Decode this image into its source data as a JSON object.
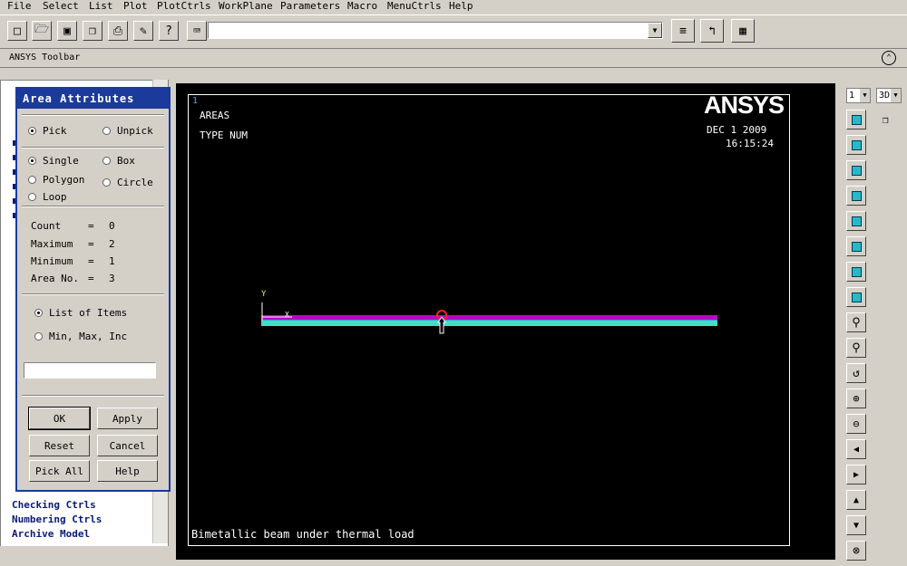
{
  "menu": {
    "items": [
      "File",
      "Select",
      "List",
      "Plot",
      "PlotCtrls",
      "WorkPlane",
      "Parameters",
      "Macro",
      "MenuCtrls",
      "Help"
    ]
  },
  "toolbar": {
    "icons": [
      "new-file-icon",
      "open-folder-icon",
      "save-icon",
      "model-icon",
      "print-icon",
      "report-icon",
      "help-icon",
      "keyboard-icon"
    ],
    "command_value": "",
    "right_icons": [
      "raise-hidden-icon",
      "reset-picking-icon",
      "contact-manager-icon"
    ]
  },
  "ansys_toolbar": {
    "label": "ANSYS Toolbar"
  },
  "main_menu": {
    "bottom_items": [
      "Checking Ctrls",
      "Numbering Ctrls",
      "Archive Model"
    ]
  },
  "dialog": {
    "title": "Area Attributes",
    "pick_label": "Pick",
    "unpick_label": "Unpick",
    "single_label": "Single",
    "box_label": "Box",
    "polygon_label": "Polygon",
    "circle_label": "Circle",
    "loop_label": "Loop",
    "count_label": "Count",
    "count_value": "0",
    "maximum_label": "Maximum",
    "maximum_value": "2",
    "minimum_label": "Minimum",
    "minimum_value": "1",
    "area_no_label": "Area No.",
    "area_no_value": "3",
    "eq": "=",
    "list_items_label": "List of Items",
    "min_max_inc_label": "Min, Max, Inc",
    "pick_field_value": "",
    "ok_label": "OK",
    "apply_label": "Apply",
    "reset_label": "Reset",
    "cancel_label": "Cancel",
    "pick_all_label": "Pick All",
    "help_label": "Help"
  },
  "graphics": {
    "window_number": "1",
    "plot_type": "AREAS",
    "type_label": "TYPE NUM",
    "logo": "ANSYS",
    "date": "DEC  1 2009",
    "time": "16:15:24",
    "axis_y": "Y",
    "axis_x": "X",
    "caption": "Bimetallic beam under thermal load",
    "colors": {
      "top_area": "#c000c0",
      "bottom_area": "#40e0c0",
      "background": "#000000"
    }
  },
  "right_toolbar": {
    "window_select": "1",
    "view_select": "3D",
    "icons": [
      "iso-view-icon",
      "oblique-view-icon",
      "front-view-icon",
      "back-view-icon",
      "top-view-icon",
      "bottom-view-icon",
      "left-view-icon",
      "right-view-icon",
      "zoom-icon",
      "box-zoom-icon",
      "win-zoom-icon",
      "zoom-in-icon",
      "zoom-out-icon",
      "pan-left-icon",
      "pan-right-icon",
      "pan-up-icon",
      "pan-down-icon",
      "rotate-icon"
    ]
  }
}
